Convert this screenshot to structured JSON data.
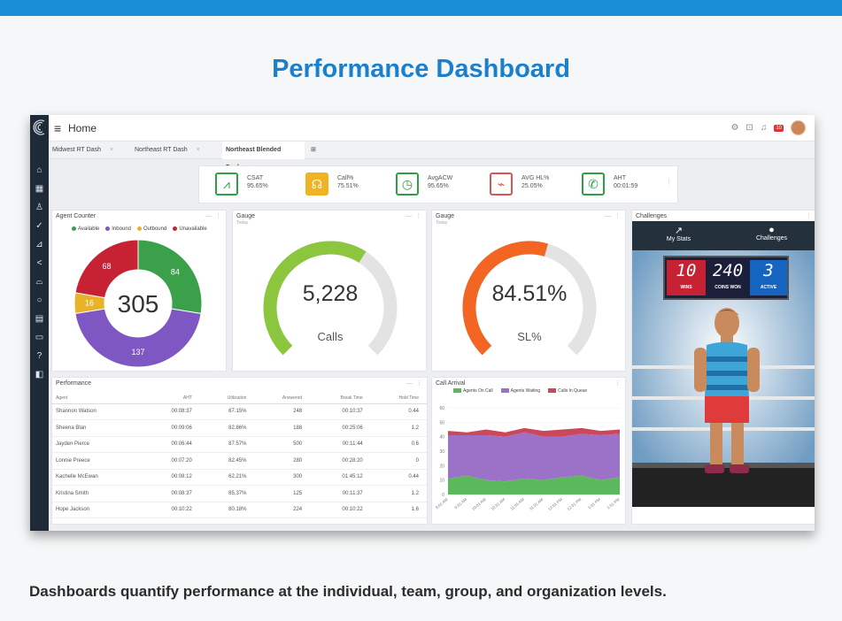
{
  "page": {
    "title": "Performance Dashboard",
    "caption": "Dashboards quantify performance at the individual, team, group, and organization levels."
  },
  "app": {
    "home_label": "Home",
    "badge_count": "10",
    "tabs": [
      {
        "label": "Midwest RT Dash"
      },
      {
        "label": "Northeast RT Dash"
      },
      {
        "label": "Northeast Blended Dash"
      }
    ]
  },
  "kpis": [
    {
      "name": "CSAT",
      "value": "95.65%",
      "icon": "trend-line-icon",
      "color": "#2ea043"
    },
    {
      "name": "Call%",
      "value": "75.51%",
      "icon": "headset-icon",
      "color": "#f0b323"
    },
    {
      "name": "AvgACW",
      "value": "95.65%",
      "icon": "clock-icon",
      "color": "#2ea043"
    },
    {
      "name": "AVG HL%",
      "value": "25.05%",
      "icon": "pulse-icon",
      "color": "#d9534f"
    },
    {
      "name": "AHT",
      "value": "00:01:59",
      "icon": "phone-icon",
      "color": "#2ea043"
    }
  ],
  "agent_counter": {
    "title": "Agent Counter",
    "total": "305",
    "legend": [
      {
        "label": "Available",
        "color": "#3aa04a"
      },
      {
        "label": "Inbound",
        "color": "#7e57c2"
      },
      {
        "label": "Outbound",
        "color": "#e8b32a"
      },
      {
        "label": "Unavailable",
        "color": "#c62234"
      }
    ],
    "segments": [
      {
        "label": "84",
        "value": 84,
        "color": "#3aa04a"
      },
      {
        "label": "137",
        "value": 137,
        "color": "#7e57c2"
      },
      {
        "label": "16",
        "value": 16,
        "color": "#e8b32a"
      },
      {
        "label": "68",
        "value": 68,
        "color": "#c62234"
      }
    ]
  },
  "gauge_calls": {
    "title": "Gauge",
    "subtitle": "Today",
    "value_label": "5,228",
    "unit": "Calls",
    "fill_fraction": 0.62,
    "color": "#8cc63f"
  },
  "gauge_sl": {
    "title": "Gauge",
    "subtitle": "Today",
    "value_label": "84.51%",
    "unit": "SL%",
    "fill_fraction": 0.56,
    "color": "#f26522"
  },
  "performance": {
    "title": "Performance",
    "columns": [
      "Agent",
      "AHT",
      "Utilization",
      "Answered",
      "Break Time",
      "Hold Time"
    ],
    "rows": [
      [
        "Shannon Watson",
        "00:08:37",
        "67.15%",
        "248",
        "00:10:37",
        "0.44"
      ],
      [
        "Sheena Blan",
        "00:09:06",
        "82.86%",
        "188",
        "00:25:06",
        "1.2"
      ],
      [
        "Jayden Pierce",
        "00:06:44",
        "87.57%",
        "500",
        "00:11:44",
        "0.6"
      ],
      [
        "Lonnie Preece",
        "00:07:20",
        "82.45%",
        "280",
        "00:28:20",
        "0"
      ],
      [
        "Kachelle McEwan",
        "00:08:12",
        "62.21%",
        "300",
        "01:45:12",
        "0.44"
      ],
      [
        "Kristina Smith",
        "00:08:37",
        "85.37%",
        "125",
        "00:11:37",
        "1.2"
      ],
      [
        "Hope Jackson",
        "00:10:22",
        "80.18%",
        "224",
        "00:10:22",
        "1.6"
      ]
    ]
  },
  "call_arrival": {
    "title": "Call Arrival",
    "legend": [
      {
        "label": "Agents On Call",
        "color": "#5cb85c"
      },
      {
        "label": "Agents Waiting",
        "color": "#9b72c8"
      },
      {
        "label": "Calls In Queue",
        "color": "#c9485b"
      }
    ],
    "yticks": [
      "0",
      "10",
      "20",
      "30",
      "40",
      "50",
      "60"
    ],
    "xticks": [
      "9:01 AM",
      "9:31 AM",
      "10:01 AM",
      "10:31 AM",
      "11:01 AM",
      "11:31 AM",
      "12:01 PM",
      "12:31 PM",
      "1:01 PM",
      "1:31 PM"
    ]
  },
  "chart_data": {
    "type": "area",
    "title": "Call Arrival",
    "x": [
      "9:01 AM",
      "9:31 AM",
      "10:01 AM",
      "10:31 AM",
      "11:01 AM",
      "11:31 AM",
      "12:01 PM",
      "12:31 PM",
      "1:01 PM",
      "1:31 PM"
    ],
    "ylim": [
      0,
      60
    ],
    "series": [
      {
        "name": "Agents On Call",
        "values": [
          11,
          13,
          10,
          9,
          11,
          10,
          12,
          13,
          10,
          12
        ]
      },
      {
        "name": "Agents Waiting",
        "values": [
          30,
          28,
          31,
          31,
          32,
          30,
          28,
          29,
          31,
          30
        ]
      },
      {
        "name": "Calls In Queue",
        "values": [
          3,
          2,
          4,
          3,
          3,
          4,
          5,
          4,
          3,
          3
        ]
      }
    ]
  },
  "challenges": {
    "title": "Challenges",
    "tabs": [
      {
        "label": "My Stats",
        "icon": "trend-arrow-icon"
      },
      {
        "label": "Challenges",
        "icon": "boxing-glove-icon"
      }
    ],
    "scoreboard": [
      {
        "value": "10",
        "label": "WINS",
        "bg": "#c62234"
      },
      {
        "value": "240",
        "label": "COINS WON",
        "bg": "#1b1f3a"
      },
      {
        "value": "3",
        "label": "ACTIVE",
        "bg": "#1565c0"
      }
    ]
  }
}
